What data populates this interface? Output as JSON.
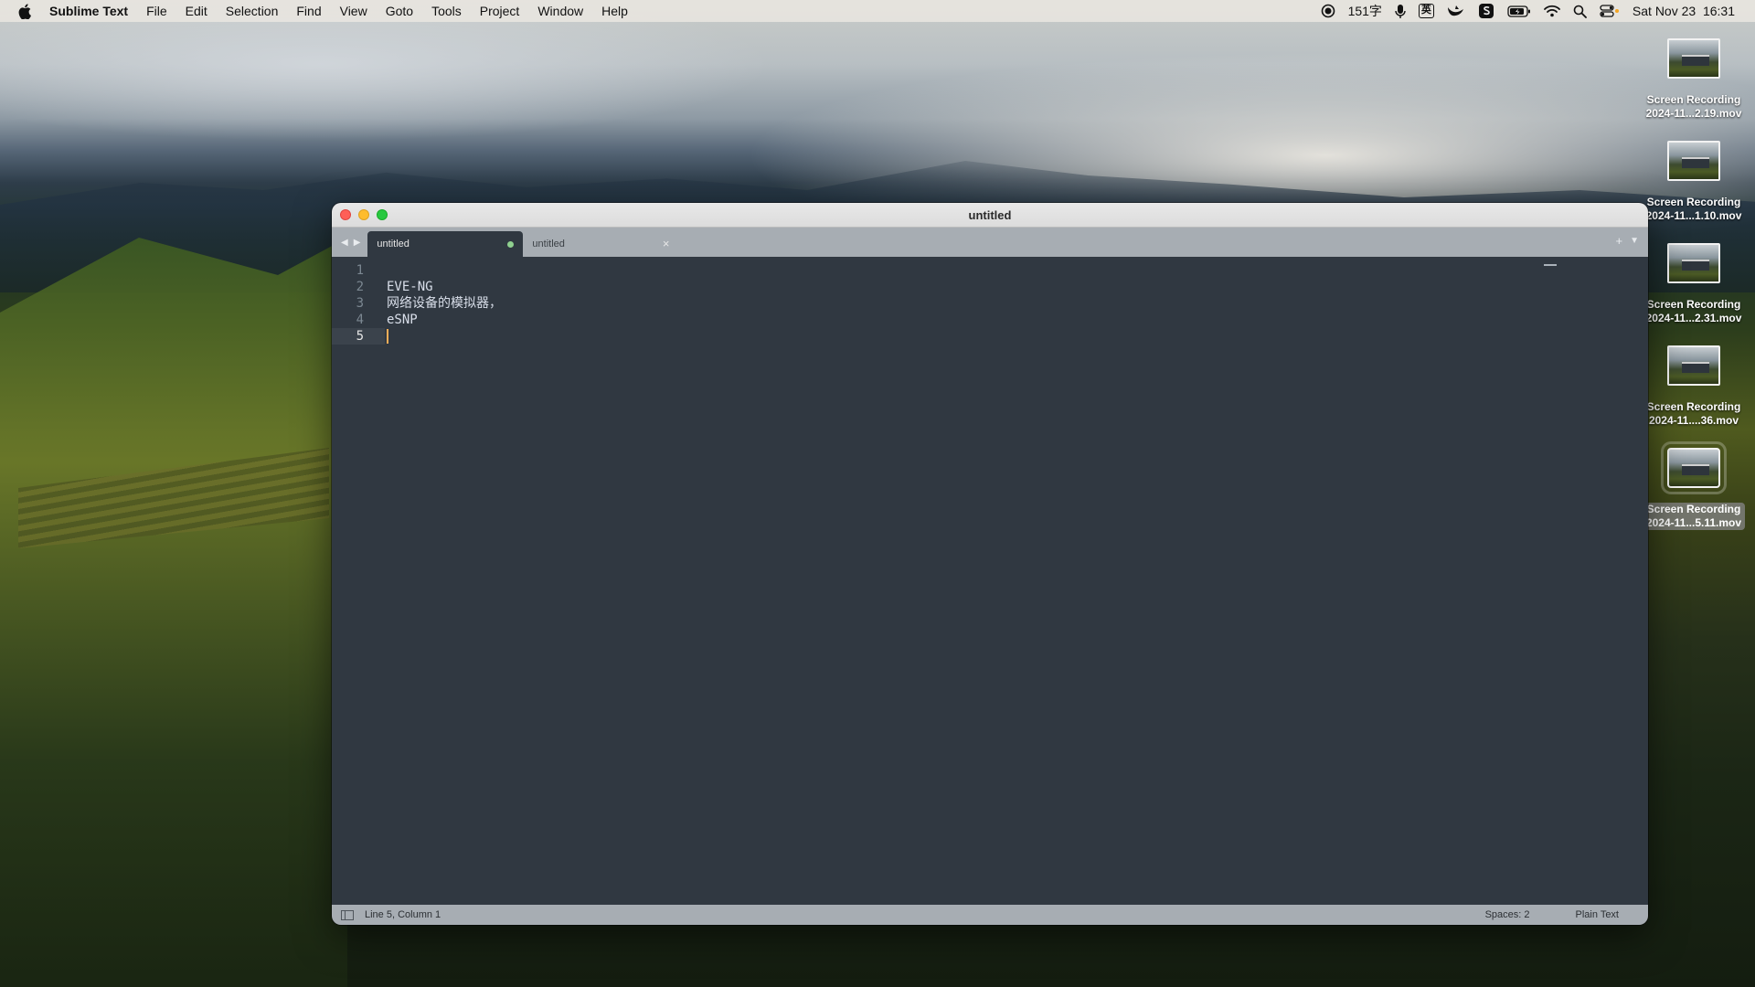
{
  "menubar": {
    "app_name": "Sublime Text",
    "menus": [
      "File",
      "Edit",
      "Selection",
      "Find",
      "View",
      "Goto",
      "Tools",
      "Project",
      "Window",
      "Help"
    ],
    "word_count": "151字",
    "input_method": "英",
    "datetime": "Sat Nov 23  16:31"
  },
  "desktop": {
    "icons": [
      {
        "line1": "Screen Recording",
        "line2": "2024-11...2.19.mov",
        "selected": false
      },
      {
        "line1": "Screen Recording",
        "line2": "2024-11...1.10.mov",
        "selected": false
      },
      {
        "line1": "Screen Recording",
        "line2": "2024-11...2.31.mov",
        "selected": false
      },
      {
        "line1": "Screen Recording",
        "line2": "2024-11....36.mov",
        "selected": false
      },
      {
        "line1": "Screen Recording",
        "line2": "2024-11...5.11.mov",
        "selected": true
      }
    ]
  },
  "window": {
    "title": "untitled",
    "tabs": [
      {
        "label": "untitled",
        "active": true,
        "dirty": true
      },
      {
        "label": "untitled",
        "active": false,
        "dirty": false
      }
    ],
    "editor": {
      "line_numbers": [
        "1",
        "2",
        "3",
        "4",
        "5"
      ],
      "lines": [
        "",
        "EVE-NG",
        "网络设备的模拟器，",
        "eSNP",
        ""
      ],
      "current_line": 5
    },
    "status": {
      "position": "Line 5, Column 1",
      "indent": "Spaces: 2",
      "syntax": "Plain Text"
    }
  }
}
